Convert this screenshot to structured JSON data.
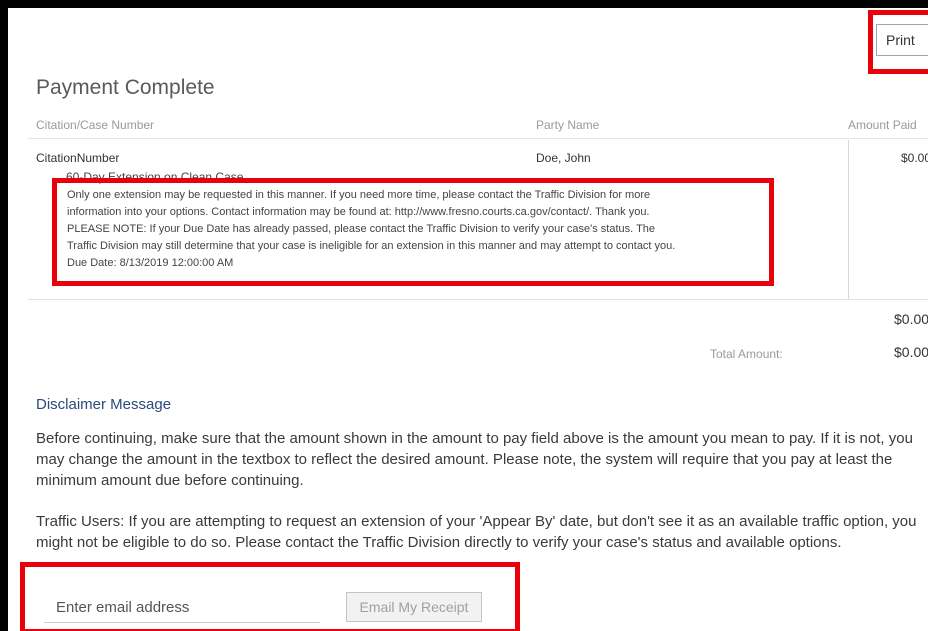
{
  "header": {
    "print_label": "Print"
  },
  "page_title": "Payment Complete",
  "table": {
    "columns": [
      "Citation/Case Number",
      "Party Name",
      "Amount Paid"
    ],
    "rows": [
      {
        "citation": "CitationNumber",
        "party": "Doe, John",
        "amount": "$0.00"
      }
    ],
    "extension": {
      "title": "60-Day Extension on Clean Case",
      "lines": [
        "Only one extension may be requested in this manner. If you need more time, please contact the Traffic Division for more",
        "information into your options. Contact information may be found at: http://www.fresno.courts.ca.gov/contact/. Thank you.",
        "PLEASE NOTE: If your Due Date has already passed, please contact the Traffic Division to verify your case's status. The",
        "Traffic Division may still determine that your case is ineligible for an extension in this manner and may attempt to contact you.",
        "Due Date: 8/13/2019 12:00:00 AM"
      ]
    },
    "subtotal": "$0.00",
    "total_label": "Total Amount:",
    "total": "$0.00"
  },
  "disclaimer": {
    "heading": "Disclaimer Message",
    "para1": "Before continuing, make sure that the amount shown in the amount to pay field above is the amount you mean to pay. If it is not, you may change the amount in the textbox to reflect the desired amount. Please note, the system will require that you pay at least the minimum amount due before continuing.",
    "para2": "Traffic Users:  If you are attempting to request an extension of your 'Appear By' date, but don't see it as an available traffic option, you might not be eligible to do so.  Please contact the Traffic Division directly to verify your case's status and available options."
  },
  "email": {
    "placeholder": "Enter email address",
    "button_label": "Email My Receipt"
  },
  "colors": {
    "highlight": "#e8000b",
    "heading_blue": "#2b4a7a"
  }
}
